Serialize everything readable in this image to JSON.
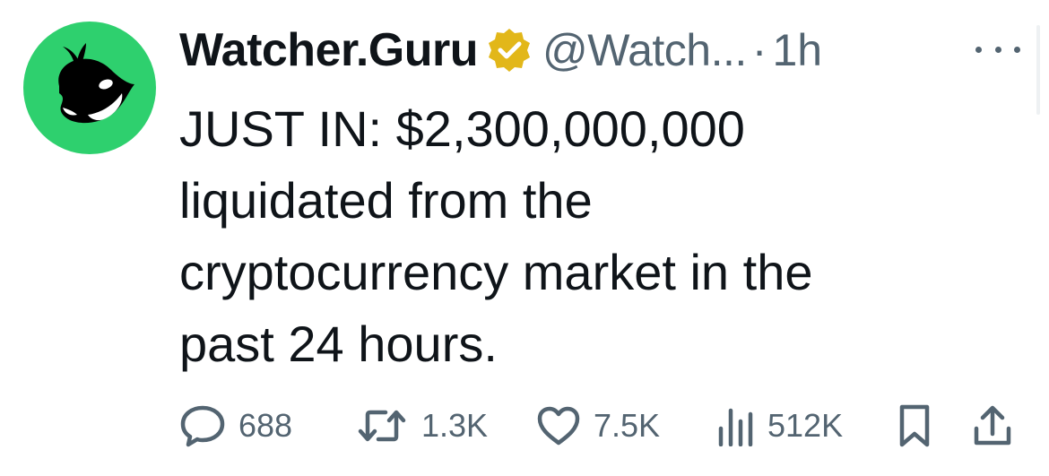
{
  "author": {
    "display_name": "Watcher.Guru",
    "handle": "@Watch...",
    "separator": "·",
    "time": "1h",
    "avatar_icon": "whale-icon",
    "avatar_color": "#2ed06e",
    "verified_color": "#e2b719"
  },
  "tweet": {
    "text": "JUST IN: $2,300,000,000\nliquidated from the\ncryptocurrency market in the\npast 24 hours."
  },
  "actions": {
    "replies": "688",
    "reposts": "1.3K",
    "likes": "7.5K",
    "views": "512K"
  },
  "icons": {
    "reply": "reply-bubble-icon",
    "repost": "repost-icon",
    "like": "heart-icon",
    "views": "views-bars-icon",
    "bookmark": "bookmark-icon",
    "share": "share-icon",
    "more": "more-dots-icon"
  },
  "colors": {
    "text": "#0f1419",
    "secondary": "#536471"
  }
}
